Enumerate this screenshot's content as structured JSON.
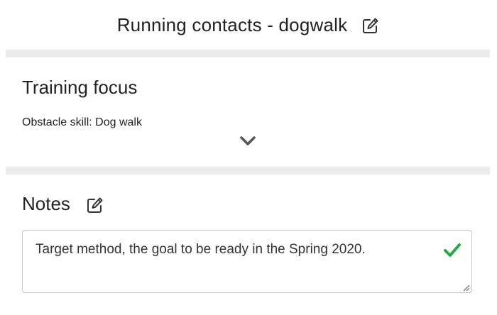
{
  "header": {
    "title": "Running contacts - dogwalk",
    "edit_icon": "edit-icon"
  },
  "training_focus": {
    "heading": "Training focus",
    "subtitle": "Obstacle skill: Dog walk",
    "expand_icon": "chevron-down-icon"
  },
  "notes": {
    "heading": "Notes",
    "edit_icon": "edit-icon",
    "value": "Target method, the goal to be ready in the Spring 2020.",
    "confirm_icon": "checkmark-icon"
  },
  "colors": {
    "separator": "#ebebeb",
    "text": "#222222",
    "icon": "#333333",
    "chevron": "#555555",
    "confirm": "#27a845",
    "input_border": "#c6c6c6"
  }
}
